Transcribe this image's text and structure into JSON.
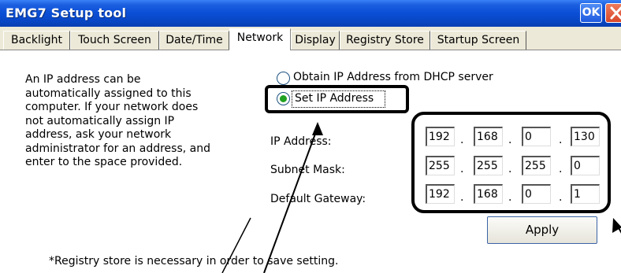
{
  "window": {
    "title": "EMG7 Setup tool",
    "ok_label": "OK"
  },
  "tabs": [
    {
      "label": "Backlight"
    },
    {
      "label": "Touch Screen"
    },
    {
      "label": "Date/Time"
    },
    {
      "label": "Network",
      "active": true
    },
    {
      "label": "Display"
    },
    {
      "label": "Registry Store"
    },
    {
      "label": "Startup Screen"
    }
  ],
  "network": {
    "description_lines": [
      "An IP address can be",
      "automatically assigned to this",
      "computer. If your network does",
      "not automatically assign IP",
      "address, ask your network",
      "administrator for an address, and",
      "enter to the space provided."
    ],
    "radio_dhcp_label": "Obtain IP Address from DHCP server",
    "radio_static_label": "Set IP Address",
    "selected_mode": "Set IP Address",
    "ip_label": "IP Address:",
    "subnet_label": "Subnet Mask:",
    "gateway_label": "Default Gateway:",
    "ip_address": [
      "192",
      "168",
      "0",
      "130"
    ],
    "subnet_mask": [
      "255",
      "255",
      "255",
      "0"
    ],
    "default_gateway": [
      "192",
      "168",
      "0",
      "1"
    ],
    "separator": ".",
    "apply_label": "Apply",
    "footnote": "*Registry store is necessary in order to save setting."
  },
  "colors": {
    "titlebar": "#0a4ed6",
    "window_bg": "#ece9d8",
    "radio_selected": "#21a121"
  },
  "icons": {
    "close": "close-icon"
  }
}
